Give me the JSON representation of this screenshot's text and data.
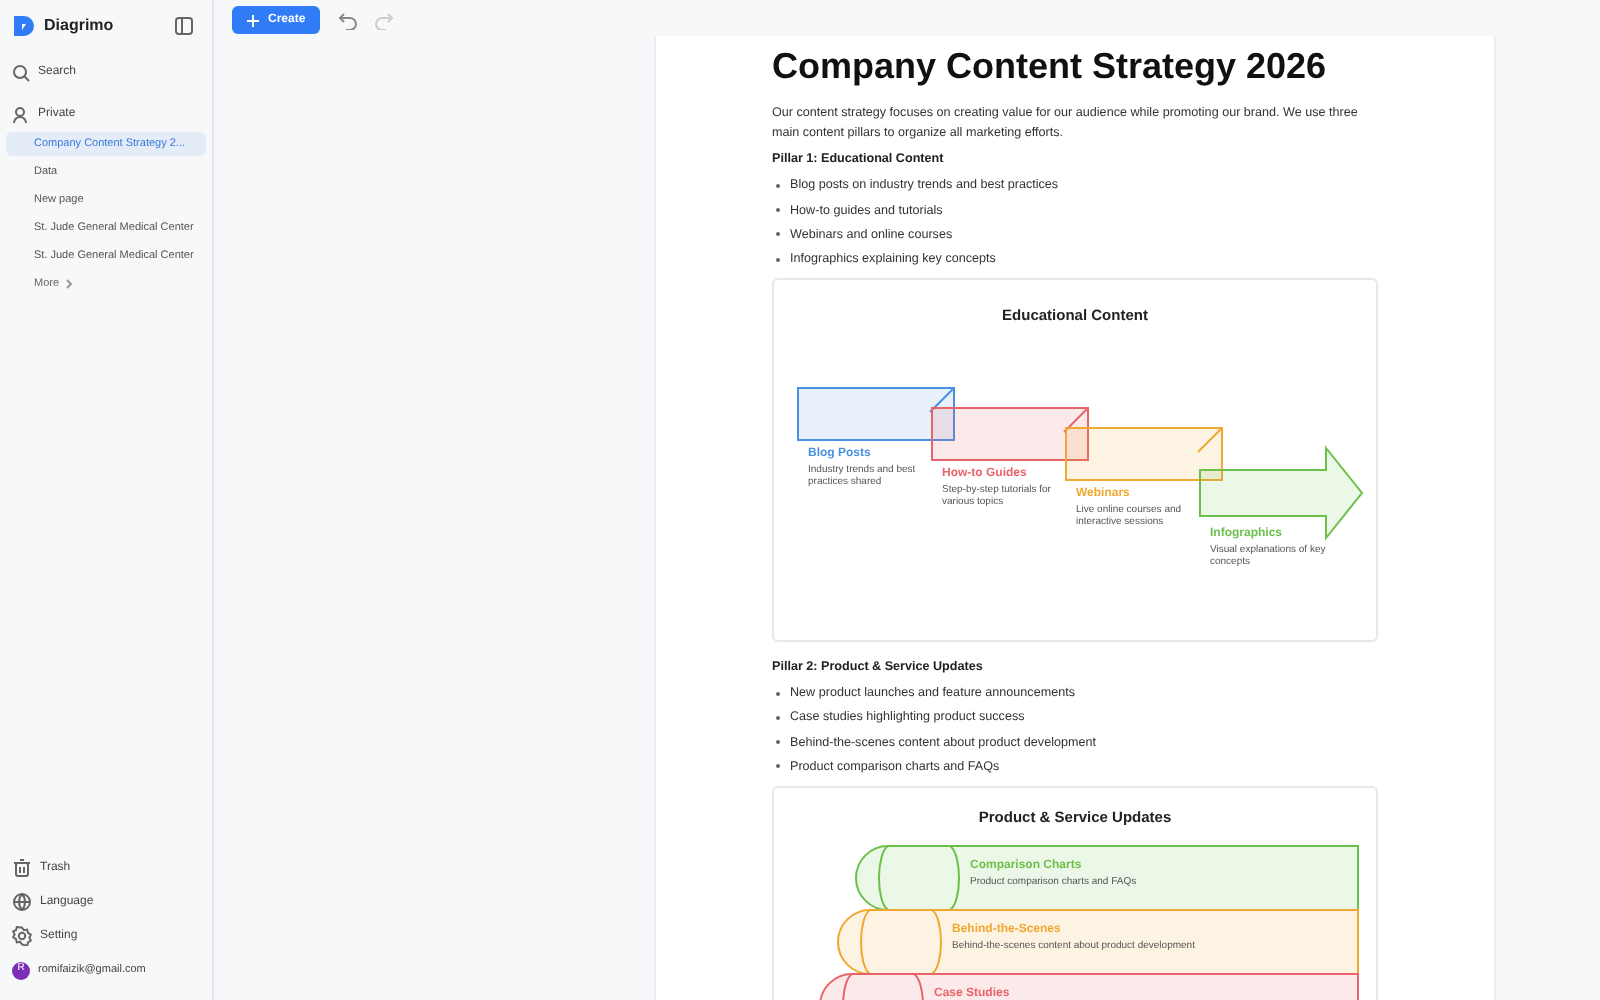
{
  "app": {
    "name": "Diagrimo"
  },
  "sidebar": {
    "search": "Search",
    "section": "Private",
    "items": [
      {
        "label": "Company Content Strategy 2...",
        "selected": true
      },
      {
        "label": "Data",
        "selected": false
      },
      {
        "label": "New page",
        "selected": false
      },
      {
        "label": "St. Jude General Medical Center",
        "selected": false
      },
      {
        "label": "St. Jude General Medical Center",
        "selected": false
      }
    ],
    "more": "More",
    "footer": [
      {
        "kind": "trash",
        "label": "Trash"
      },
      {
        "kind": "language",
        "label": "Language"
      },
      {
        "kind": "setting",
        "label": "Setting"
      }
    ],
    "account": {
      "initial": "R",
      "email": "romifaizik@gmail.com"
    }
  },
  "toolbar": {
    "create": "Create"
  },
  "document": {
    "title": "Company Content Strategy 2026",
    "intro": "Our content strategy focuses on creating value for our audience while promoting our brand. We use three main content pillars to organize all marketing efforts.",
    "sections": [
      {
        "heading": "Pillar 1: Educational Content",
        "bullets": [
          "Blog posts on industry trends and best practices",
          "How-to guides and tutorials",
          "Webinars and online courses",
          "Infographics explaining key concepts"
        ],
        "diagram": {
          "kind": "steps",
          "title": "Educational Content",
          "items": [
            {
              "title": "Blog Posts",
              "text": "Industry trends and best practices shared",
              "color": "#4a90e2"
            },
            {
              "title": "How-to Guides",
              "text": "Step-by-step tutorials for various topics",
              "color": "#e8646a"
            },
            {
              "title": "Webinars",
              "text": "Live online courses and interactive sessions",
              "color": "#f0a830"
            },
            {
              "title": "Infographics",
              "text": "Visual explanations of key concepts",
              "color": "#6cc04a"
            }
          ]
        }
      },
      {
        "heading": "Pillar 2: Product & Service Updates",
        "bullets": [
          "New product launches and feature announcements",
          "Case studies highlighting product success",
          "Behind-the-scenes content about product development",
          "Product comparison charts and FAQs"
        ],
        "diagram": {
          "kind": "layers",
          "title": "Product & Service Updates",
          "items": [
            {
              "title": "Comparison Charts",
              "text": "Product comparison charts and FAQs",
              "color": "#6cc04a"
            },
            {
              "title": "Behind-the-Scenes",
              "text": "Behind-the-scenes content about product development",
              "color": "#f0a830"
            },
            {
              "title": "Case Studies",
              "color": "#e8646a"
            }
          ]
        }
      }
    ]
  }
}
